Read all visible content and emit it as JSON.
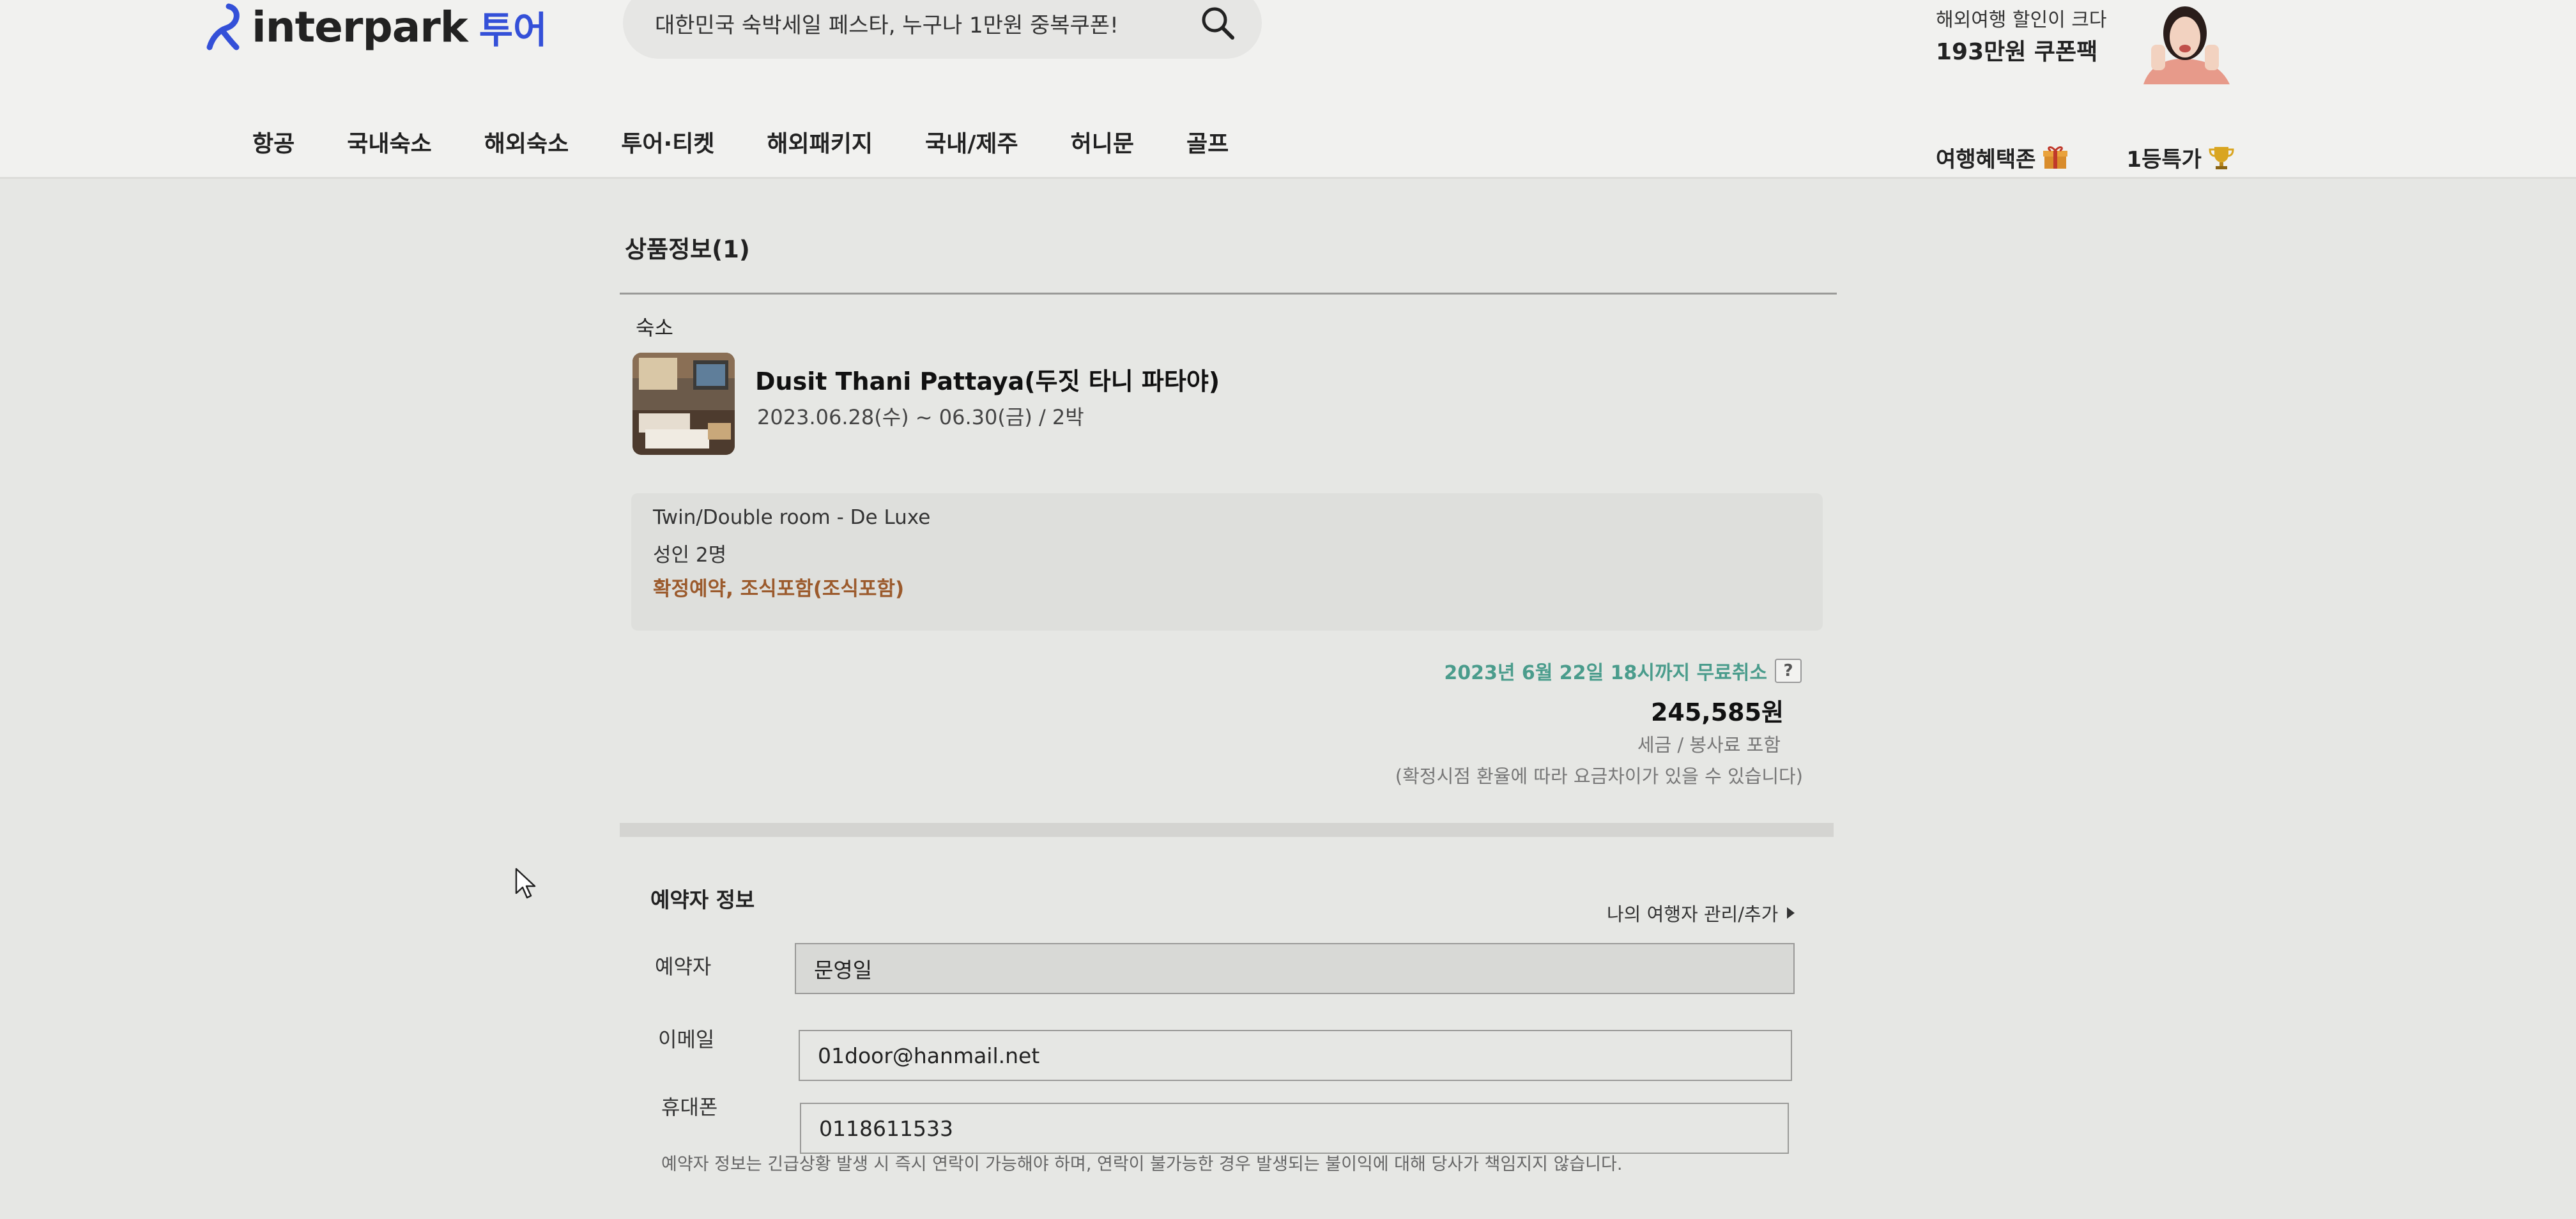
{
  "header": {
    "logo_text": "interpark",
    "logo_sub": "투어",
    "search_text": "대한민국 숙박세일 페스타, 누구나 1만원 중복쿠폰!",
    "promo": {
      "line1": "해외여행 할인이 크다",
      "line2": "193만원 쿠폰팩"
    },
    "nav": [
      {
        "label": "항공"
      },
      {
        "label": "국내숙소"
      },
      {
        "label": "해외숙소"
      },
      {
        "label": "투어·티켓"
      },
      {
        "label": "해외패키지"
      },
      {
        "label": "국내/제주"
      },
      {
        "label": "허니문"
      },
      {
        "label": "골프"
      }
    ],
    "util": [
      {
        "label": "여행혜택존",
        "icon": "gift-icon"
      },
      {
        "label": "1등특가",
        "icon": "trophy-icon"
      }
    ]
  },
  "product": {
    "section_title": "상품정보(1)",
    "category": "숙소",
    "hotel_name": "Dusit Thani Pattaya(두짓 타니 파타야)",
    "dates": "2023.06.28(수) ~ 06.30(금) / 2박",
    "room_type": "Twin/Double room - De Luxe",
    "guests": "성인 2명",
    "tags": "확정예약, 조식포함(조식포함)",
    "free_cancel": "2023년 6월 22일 18시까지 무료취소",
    "help": "?",
    "price": "245,585원",
    "tax_note": "세금 / 봉사료 포함",
    "rate_note": "(확정시점 환율에 따라 요금차이가 있을 수 있습니다)"
  },
  "booker": {
    "title": "예약자 정보",
    "manage_link": "나의 여행자 관리/추가",
    "name_label": "예약자",
    "name_value": "문영일",
    "email_label": "이메일",
    "email_value": "01door@hanmail.net",
    "phone_label": "휴대폰",
    "phone_value": "0118611533",
    "notice": "예약자 정보는 긴급상황 발생 시 즉시 연락이 가능해야 하며, 연락이 불가능한 경우 발생되는 불이익에 대해 당사가 책임지지 않습니다."
  },
  "colors": {
    "brand_blue": "#3450d8",
    "free_cancel_green": "#4a9c8c",
    "tag_brown": "#9b5a2c"
  }
}
